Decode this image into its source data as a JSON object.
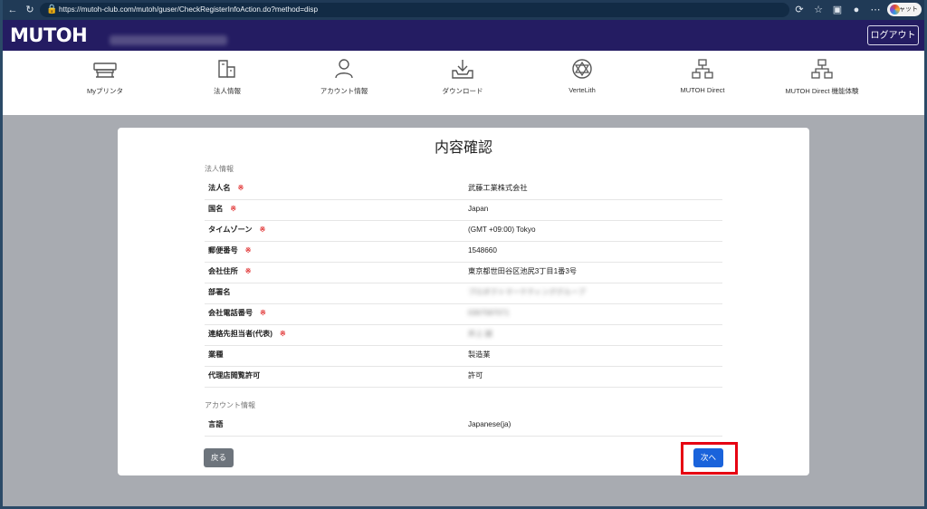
{
  "browser": {
    "url": "https://mutoh-club.com/mutoh/guser/CheckRegisterInfoAction.do?method=disp",
    "chat_label": "チャット"
  },
  "header": {
    "brand": "MUTOH",
    "user_email": "(Makoto_Inoue@mutoh.co.jp)",
    "logout_label": "ログアウト"
  },
  "nav": {
    "items": [
      {
        "label": "Myプリンタ",
        "icon": "printer-icon"
      },
      {
        "label": "法人情報",
        "icon": "building-icon"
      },
      {
        "label": "アカウント情報",
        "icon": "user-icon"
      },
      {
        "label": "ダウンロード",
        "icon": "download-icon"
      },
      {
        "label": "VerteLith",
        "icon": "vertelith-icon"
      },
      {
        "label": "MUTOH Direct",
        "icon": "network-icon"
      },
      {
        "label": "MUTOH Direct 機能体験",
        "icon": "network-icon"
      }
    ]
  },
  "page": {
    "title": "内容確認",
    "required_mark": "※",
    "corporate_section_label": "法人情報",
    "corporate_rows": [
      {
        "label": "法人名",
        "value": "武藤工業株式会社",
        "required": true
      },
      {
        "label": "国名",
        "value": "Japan",
        "required": true
      },
      {
        "label": "タイムゾーン",
        "value": "(GMT +09:00) Tokyo",
        "required": true
      },
      {
        "label": "郵便番号",
        "value": "1548660",
        "required": true
      },
      {
        "label": "会社住所",
        "value": "東京都世田谷区池尻3丁目1番3号",
        "required": true
      },
      {
        "label": "部署名",
        "value": "プロダクトマーケティンググループ",
        "required": false,
        "redacted": true
      },
      {
        "label": "会社電話番号",
        "value": "0367587071",
        "required": true,
        "redacted": true
      },
      {
        "label": "連絡先担当者(代表)",
        "value": "井上 誠",
        "required": true,
        "redacted": true
      },
      {
        "label": "業種",
        "value": "製造業",
        "required": false
      },
      {
        "label": "代理店閲覧許可",
        "value": "許可",
        "required": false
      }
    ],
    "account_section_label": "アカウント情報",
    "account_rows": [
      {
        "label": "言語",
        "value": "Japanese(ja)",
        "required": false
      }
    ],
    "back_label": "戻る",
    "next_label": "次へ"
  },
  "colors": {
    "header_bg": "#241c62",
    "required": "#e23c3c",
    "next_button": "#1a63db",
    "highlight": "#e60012"
  }
}
